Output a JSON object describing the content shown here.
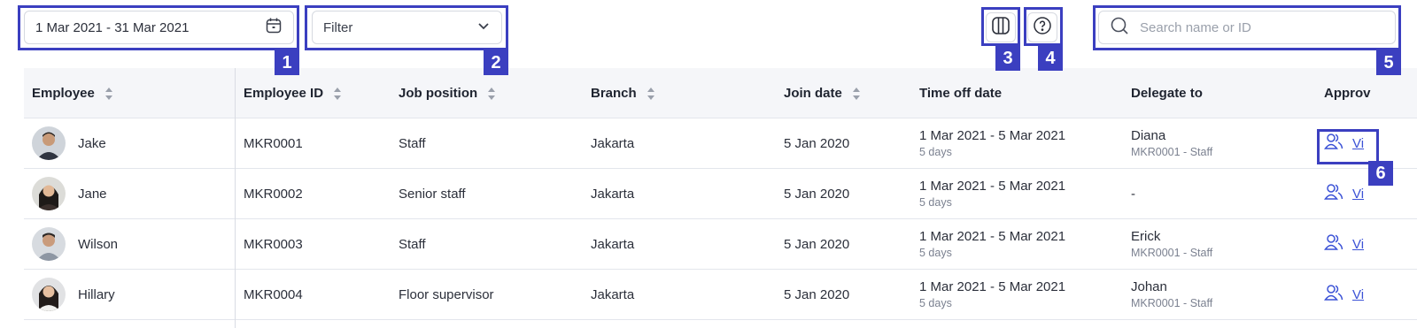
{
  "toolbar": {
    "date_range": "1 Mar 2021 - 31 Mar 2021",
    "filter_label": "Filter",
    "search_placeholder": "Search name or ID"
  },
  "annotations": [
    "1",
    "2",
    "3",
    "4",
    "5",
    "6"
  ],
  "table": {
    "headers": {
      "employee": "Employee",
      "employee_id": "Employee ID",
      "job_position": "Job position",
      "branch": "Branch",
      "join_date": "Join date",
      "time_off_date": "Time off date",
      "delegate_to": "Delegate to",
      "approval": "Approv"
    },
    "rows": [
      {
        "name": "Jake",
        "id": "MKR0001",
        "position": "Staff",
        "branch": "Jakarta",
        "join": "5 Jan 2020",
        "timeoff": "1 Mar 2021 - 5 Mar 2021",
        "days": "5 days",
        "delegate": "Diana",
        "delegate_sub": "MKR0001 - Staff",
        "view": "Vi"
      },
      {
        "name": "Jane",
        "id": "MKR0002",
        "position": "Senior staff",
        "branch": "Jakarta",
        "join": "5 Jan 2020",
        "timeoff": "1 Mar 2021 - 5 Mar 2021",
        "days": "5 days",
        "delegate": "-",
        "delegate_sub": "",
        "view": "Vi"
      },
      {
        "name": "Wilson",
        "id": "MKR0003",
        "position": "Staff",
        "branch": "Jakarta",
        "join": "5 Jan 2020",
        "timeoff": "1 Mar 2021 - 5 Mar 2021",
        "days": "5 days",
        "delegate": "Erick",
        "delegate_sub": "MKR0001 - Staff",
        "view": "Vi"
      },
      {
        "name": "Hillary",
        "id": "MKR0004",
        "position": "Floor supervisor",
        "branch": "Jakarta",
        "join": "5 Jan 2020",
        "timeoff": "1 Mar 2021 - 5 Mar 2021",
        "days": "5 days",
        "delegate": "Johan",
        "delegate_sub": "MKR0001 - Staff",
        "view": "Vi"
      }
    ]
  },
  "colors": {
    "accent": "#3b3fc0",
    "link": "#3b52d6",
    "header_bg": "#f5f6f9"
  }
}
